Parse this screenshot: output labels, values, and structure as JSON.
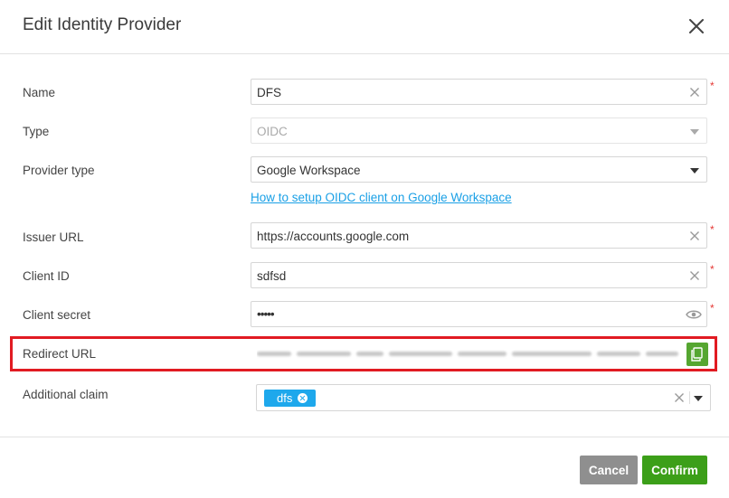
{
  "dialog": {
    "title": "Edit Identity Provider"
  },
  "form": {
    "name": {
      "label": "Name",
      "value": "DFS",
      "required_mark": "*"
    },
    "type": {
      "label": "Type",
      "value": "OIDC"
    },
    "provider_type": {
      "label": "Provider type",
      "value": "Google Workspace"
    },
    "setup_link": {
      "text": "How to setup OIDC client on Google Workspace"
    },
    "issuer_url": {
      "label": "Issuer URL",
      "value": "https://accounts.google.com",
      "required_mark": "*"
    },
    "client_id": {
      "label": "Client ID",
      "value": "sdfsd",
      "required_mark": "*"
    },
    "client_secret": {
      "label": "Client secret",
      "value": "•••••",
      "required_mark": "*"
    },
    "redirect_url": {
      "label": "Redirect URL"
    },
    "additional_claim": {
      "label": "Additional claim",
      "tags": [
        "dfs"
      ]
    }
  },
  "footer": {
    "cancel_label": "Cancel",
    "confirm_label": "Confirm"
  },
  "colors": {
    "accent_link": "#1aa0e6",
    "confirm_green": "#3c9f19",
    "copy_green": "#55a630",
    "highlight_red": "#e11b22",
    "tag_blue": "#1ea8ec",
    "required_red": "#e53935"
  },
  "icons": {
    "close": "close-icon",
    "clear": "clear-icon",
    "dropdown": "chevron-down-icon",
    "reveal": "eye-icon",
    "copy": "copy-icon",
    "tag_remove": "tag-remove-icon"
  }
}
